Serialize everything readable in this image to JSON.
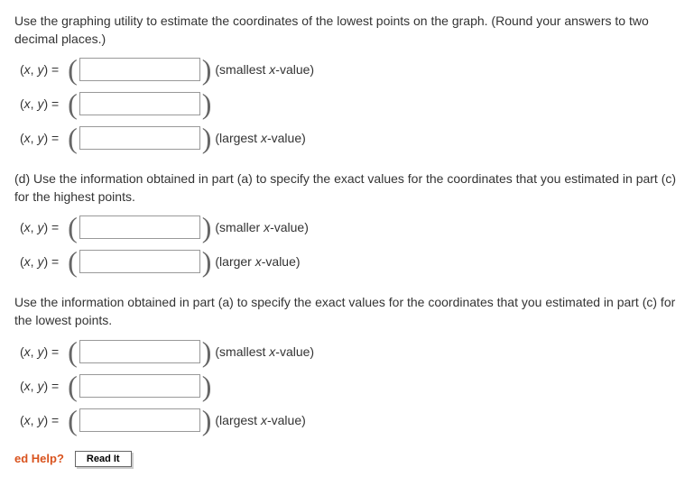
{
  "section_c": {
    "prompt": "Use the graphing utility to estimate the coordinates of the lowest points on the graph. (Round your answers to two decimal places.)",
    "rows": [
      {
        "hint_pre": "(smallest ",
        "hint_var": "x",
        "hint_post": "-value)"
      },
      {
        "hint_pre": "",
        "hint_var": "",
        "hint_post": ""
      },
      {
        "hint_pre": "(largest ",
        "hint_var": "x",
        "hint_post": "-value)"
      }
    ]
  },
  "section_d_high": {
    "prompt": "(d) Use the information obtained in part (a) to specify the exact values for the coordinates that you estimated in part (c) for the highest points.",
    "rows": [
      {
        "hint_pre": "(smaller ",
        "hint_var": "x",
        "hint_post": "-value)"
      },
      {
        "hint_pre": "(larger ",
        "hint_var": "x",
        "hint_post": "-value)"
      }
    ]
  },
  "section_d_low": {
    "prompt": "Use the information obtained in part (a) to specify the exact values for the coordinates that you estimated in part (c) for the lowest points.",
    "rows": [
      {
        "hint_pre": "(smallest ",
        "hint_var": "x",
        "hint_post": "-value)"
      },
      {
        "hint_pre": "",
        "hint_var": "",
        "hint_post": ""
      },
      {
        "hint_pre": "(largest ",
        "hint_var": "x",
        "hint_post": "-value)"
      }
    ]
  },
  "labels": {
    "xy_prefix": "(",
    "xy_x": "x",
    "xy_sep": ", ",
    "xy_y": "y",
    "xy_eq": ") = ",
    "help": "ed Help?",
    "read_it": "Read It"
  }
}
